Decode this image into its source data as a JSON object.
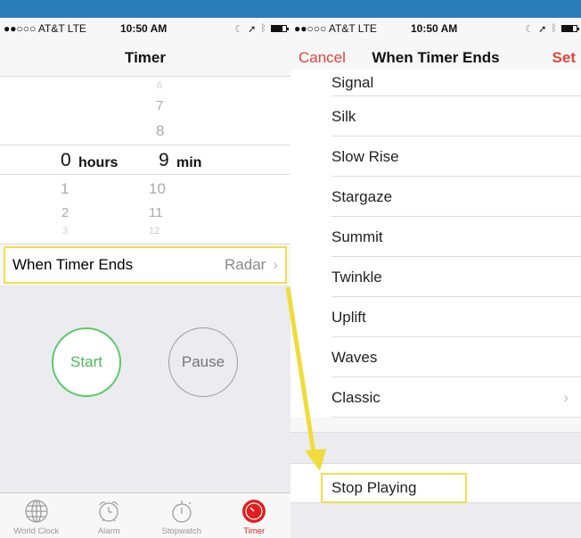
{
  "status": {
    "carrier": "●●○○○ AT&T  LTE",
    "time": "10:50 AM"
  },
  "left": {
    "title": "Timer",
    "picker": {
      "hours_above": [],
      "minutes_above": [
        "6",
        "7",
        "8"
      ],
      "selected_hours": "0",
      "hours_unit": "hours",
      "selected_minutes": "9",
      "minutes_unit": "min",
      "hours_below": [
        "1",
        "2",
        "3"
      ],
      "minutes_below": [
        "10",
        "11",
        "12"
      ]
    },
    "when_timer_ends": {
      "label": "When Timer Ends",
      "value": "Radar",
      "chevron": "›"
    },
    "start_label": "Start",
    "pause_label": "Pause",
    "tabs": [
      {
        "label": "World Clock",
        "icon": "globe-icon"
      },
      {
        "label": "Alarm",
        "icon": "alarm-clock-icon"
      },
      {
        "label": "Stopwatch",
        "icon": "stopwatch-icon"
      },
      {
        "label": "Timer",
        "icon": "timer-icon",
        "active": true
      }
    ]
  },
  "right": {
    "cancel_label": "Cancel",
    "title": "When Timer Ends",
    "set_label": "Set",
    "sounds": [
      "Signal",
      "Silk",
      "Slow Rise",
      "Stargaze",
      "Summit",
      "Twinkle",
      "Uplift",
      "Waves",
      "Classic"
    ],
    "classic_chevron": "›",
    "stop_playing": "Stop Playing"
  },
  "colors": {
    "accent_red": "#e0443e",
    "start_green": "#4cb85d",
    "highlight_yellow": "#f0e04a"
  }
}
